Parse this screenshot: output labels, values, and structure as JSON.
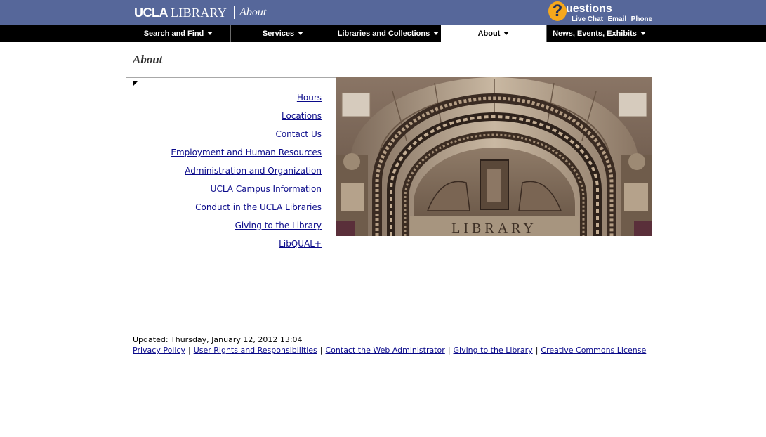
{
  "header": {
    "logo_ucla": "UCLA",
    "logo_library": "LIBRARY",
    "section": "About",
    "questions_badge": "?",
    "questions_word": "uestions",
    "live_chat": "Live Chat",
    "email": "Email",
    "phone": "Phone",
    "brand_color": "#56679a",
    "accent_color": "#f6a81c"
  },
  "nav": [
    {
      "label": "Search and Find",
      "active": false
    },
    {
      "label": "Services",
      "active": false
    },
    {
      "label": "Libraries and Collections",
      "active": false
    },
    {
      "label": "About",
      "active": true
    },
    {
      "label": "News, Events, Exhibits",
      "active": false
    }
  ],
  "page": {
    "title": "About"
  },
  "side_links": [
    "Hours",
    "Locations",
    "Contact Us",
    "Employment and Human Resources",
    "Administration and Organization",
    "UCLA Campus Information",
    "Conduct in the UCLA Libraries",
    "Giving to the Library",
    "LibQUAL+"
  ],
  "hero": {
    "inscription": "LIBRARY"
  },
  "footer": {
    "updated": "Updated: Thursday, January 12, 2012 13:04",
    "links": [
      "Privacy Policy",
      "User Rights and Responsibilities",
      "Contact the Web Administrator",
      "Giving to the Library",
      "Creative Commons License"
    ],
    "separator": "|"
  },
  "colors": {
    "link": "#0a0a8a",
    "nav_bg": "#000000"
  }
}
